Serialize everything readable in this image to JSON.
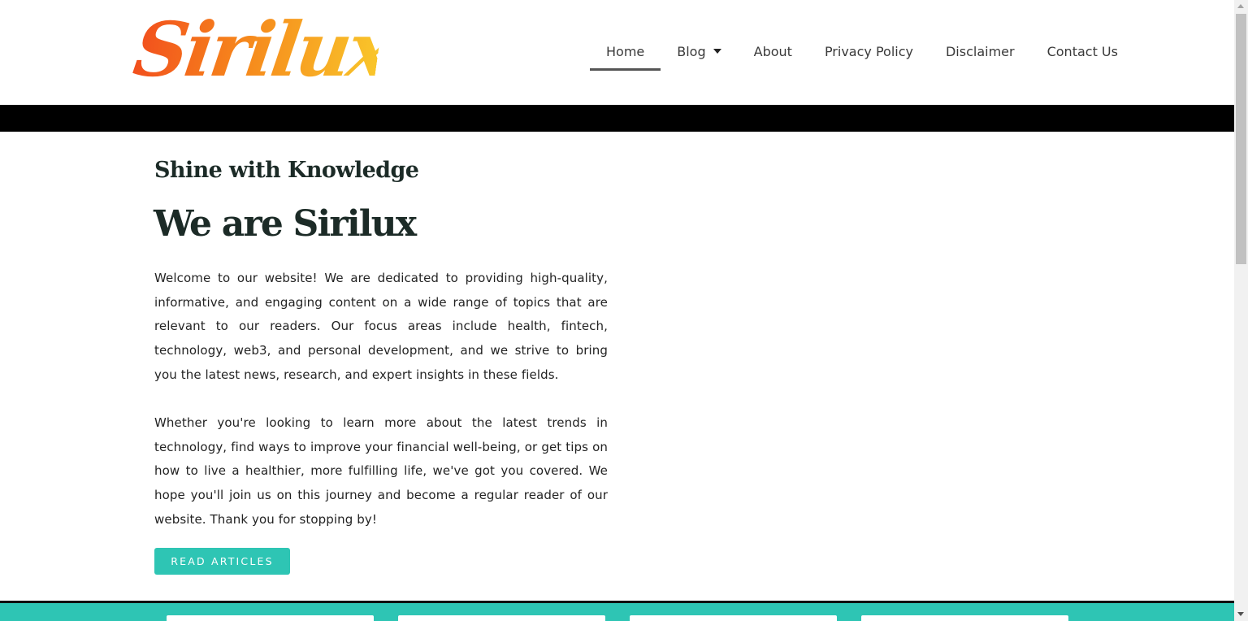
{
  "header": {
    "logo_text": "Sirilux",
    "nav": [
      {
        "label": "Home",
        "active": true
      },
      {
        "label": "Blog",
        "has_dropdown": true
      },
      {
        "label": "About"
      },
      {
        "label": "Privacy Policy"
      },
      {
        "label": "Disclaimer"
      },
      {
        "label": "Contact Us"
      }
    ]
  },
  "hero": {
    "tagline": "Shine with Knowledge",
    "title": "We are Sirilux",
    "paragraph1": "Welcome to our website! We are dedicated to providing high-quality, informative, and engaging content on a wide range of topics that are relevant to our readers. Our focus areas include health, fintech, technology, web3, and personal development, and we strive to bring you the latest news, research, and expert insights in these fields.",
    "paragraph2": "Whether you're looking to learn more about the latest trends in technology, find ways to improve your financial well-being, or get tips on how to live a healthier, more fulfilling life, we've got you covered. We hope you'll join us on this journey and become a regular reader of our website. Thank you for stopping by!",
    "cta_label": "READ ARTICLES"
  },
  "colors": {
    "accent": "#2ec5b4",
    "heading": "#1c2b27",
    "logo_gradient": [
      "#f24f1d",
      "#f6881c",
      "#f9c52a"
    ]
  },
  "icons": {
    "blog_dropdown": "caret-down-icon"
  }
}
